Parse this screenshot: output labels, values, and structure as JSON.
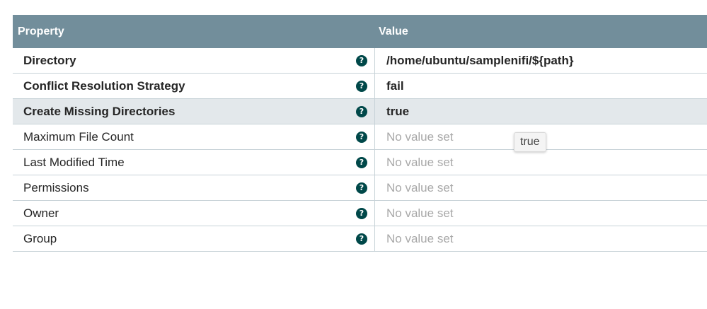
{
  "header": {
    "property_label": "Property",
    "value_label": "Value"
  },
  "rows": [
    {
      "name": "Directory",
      "value": "/home/ubuntu/samplenifi/${path}",
      "required": true,
      "is_set": true
    },
    {
      "name": "Conflict Resolution Strategy",
      "value": "fail",
      "required": true,
      "is_set": true
    },
    {
      "name": "Create Missing Directories",
      "value": "true",
      "required": true,
      "is_set": true
    },
    {
      "name": "Maximum File Count",
      "value": "No value set",
      "required": false,
      "is_set": false
    },
    {
      "name": "Last Modified Time",
      "value": "No value set",
      "required": false,
      "is_set": false
    },
    {
      "name": "Permissions",
      "value": "No value set",
      "required": false,
      "is_set": false
    },
    {
      "name": "Owner",
      "value": "No value set",
      "required": false,
      "is_set": false
    },
    {
      "name": "Group",
      "value": "No value set",
      "required": false,
      "is_set": false
    }
  ],
  "tooltip": {
    "text": "true"
  },
  "icons": {
    "help": "question-circle-icon"
  },
  "colors": {
    "header_bg": "#728e9b",
    "help_icon": "#004849",
    "selected_row": "#e3e8eb",
    "unset_text": "#a8a8a8"
  }
}
